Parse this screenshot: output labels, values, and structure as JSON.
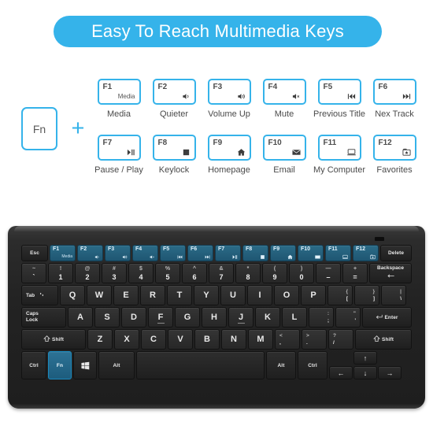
{
  "banner": {
    "title": "Easy To Reach Multimedia Keys",
    "bg_color": "#35b3ea",
    "text_color": "#ffffff"
  },
  "diagram": {
    "fn_key_label": "Fn",
    "plus_symbol": "+",
    "accent_color": "#35b3ea",
    "keys": [
      {
        "fkey": "F1",
        "icon": "media-text-icon",
        "icon_text": "Media",
        "caption": "Media"
      },
      {
        "fkey": "F2",
        "icon": "volume-down-icon",
        "icon_text": "",
        "caption": "Quieter"
      },
      {
        "fkey": "F3",
        "icon": "volume-up-icon",
        "icon_text": "",
        "caption": "Volume Up"
      },
      {
        "fkey": "F4",
        "icon": "volume-mute-icon",
        "icon_text": "",
        "caption": "Mute"
      },
      {
        "fkey": "F5",
        "icon": "previous-track-icon",
        "icon_text": "",
        "caption": "Previous Title"
      },
      {
        "fkey": "F6",
        "icon": "next-track-icon",
        "icon_text": "",
        "caption": "Nex Track"
      },
      {
        "fkey": "F7",
        "icon": "play-pause-icon",
        "icon_text": "",
        "caption": "Pause / Play"
      },
      {
        "fkey": "F8",
        "icon": "stop-square-icon",
        "icon_text": "",
        "caption": "Keylock"
      },
      {
        "fkey": "F9",
        "icon": "home-icon",
        "icon_text": "",
        "caption": "Homepage"
      },
      {
        "fkey": "F10",
        "icon": "envelope-icon",
        "icon_text": "",
        "caption": "Email"
      },
      {
        "fkey": "F11",
        "icon": "computer-monitor-icon",
        "icon_text": "",
        "caption": "My Computer"
      },
      {
        "fkey": "F12",
        "icon": "favorites-star-icon",
        "icon_text": "",
        "caption": "Favorites"
      }
    ]
  },
  "keyboard": {
    "fn_highlight_color": "#1d5c7d",
    "function_row_color": "#24627f",
    "row_function": {
      "esc": "Esc",
      "delete": "Delete",
      "fkeys": [
        {
          "label": "F1",
          "icon": "media-text-icon",
          "icon_text": "Media"
        },
        {
          "label": "F2",
          "icon": "volume-down-icon",
          "icon_text": ""
        },
        {
          "label": "F3",
          "icon": "volume-up-icon",
          "icon_text": ""
        },
        {
          "label": "F4",
          "icon": "volume-mute-icon",
          "icon_text": ""
        },
        {
          "label": "F5",
          "icon": "previous-track-icon",
          "icon_text": ""
        },
        {
          "label": "F6",
          "icon": "next-track-icon",
          "icon_text": ""
        },
        {
          "label": "F7",
          "icon": "play-pause-icon",
          "icon_text": ""
        },
        {
          "label": "F8",
          "icon": "stop-square-icon",
          "icon_text": ""
        },
        {
          "label": "F9",
          "icon": "home-icon",
          "icon_text": ""
        },
        {
          "label": "F10",
          "icon": "envelope-icon",
          "icon_text": ""
        },
        {
          "label": "F11",
          "icon": "computer-monitor-icon",
          "icon_text": ""
        },
        {
          "label": "F12",
          "icon": "favorites-star-icon",
          "icon_text": ""
        }
      ]
    },
    "row_numbers": {
      "keys": [
        {
          "upper": "~",
          "lower": "`"
        },
        {
          "upper": "!",
          "lower": "1"
        },
        {
          "upper": "@",
          "lower": "2"
        },
        {
          "upper": "#",
          "lower": "3"
        },
        {
          "upper": "$",
          "lower": "4"
        },
        {
          "upper": "%",
          "lower": "5"
        },
        {
          "upper": "^",
          "lower": "6"
        },
        {
          "upper": "&",
          "lower": "7"
        },
        {
          "upper": "*",
          "lower": "8"
        },
        {
          "upper": "(",
          "lower": "9"
        },
        {
          "upper": ")",
          "lower": "0"
        },
        {
          "upper": "—",
          "lower": "–"
        },
        {
          "upper": "+",
          "lower": "="
        }
      ],
      "backspace": "Backspace"
    },
    "row_qwerty": {
      "tab": "Tab",
      "letters": [
        "Q",
        "W",
        "E",
        "R",
        "T",
        "Y",
        "U",
        "I",
        "O",
        "P"
      ],
      "brackets": [
        {
          "upper": "{",
          "lower": "["
        },
        {
          "upper": "}",
          "lower": "]"
        },
        {
          "upper": "|",
          "lower": "\\"
        }
      ]
    },
    "row_home": {
      "caps_line1": "Caps",
      "caps_line2": "Lock",
      "letters": [
        "A",
        "S",
        "D",
        "F",
        "G",
        "H",
        "J",
        "K",
        "L"
      ],
      "punct": [
        {
          "upper": ":",
          "lower": ";"
        },
        {
          "upper": "\"",
          "lower": "'"
        }
      ],
      "enter": "Enter"
    },
    "row_shift": {
      "shift_left": "Shift",
      "letters": [
        "Z",
        "X",
        "C",
        "V",
        "B",
        "N",
        "M"
      ],
      "punct": [
        {
          "upper": "<",
          "lower": ","
        },
        {
          "upper": ">",
          "lower": "."
        },
        {
          "upper": "?",
          "lower": "/"
        }
      ],
      "shift_right": "Shift"
    },
    "row_bottom": {
      "ctrl_left": "Ctrl",
      "fn": "Fn",
      "win": "windows-logo-icon",
      "alt_left": "Alt",
      "space": "",
      "alt_right": "Alt",
      "ctrl_right": "Ctrl",
      "arrows": {
        "up": "↑",
        "left": "←",
        "down": "↓",
        "right": "→"
      }
    }
  }
}
